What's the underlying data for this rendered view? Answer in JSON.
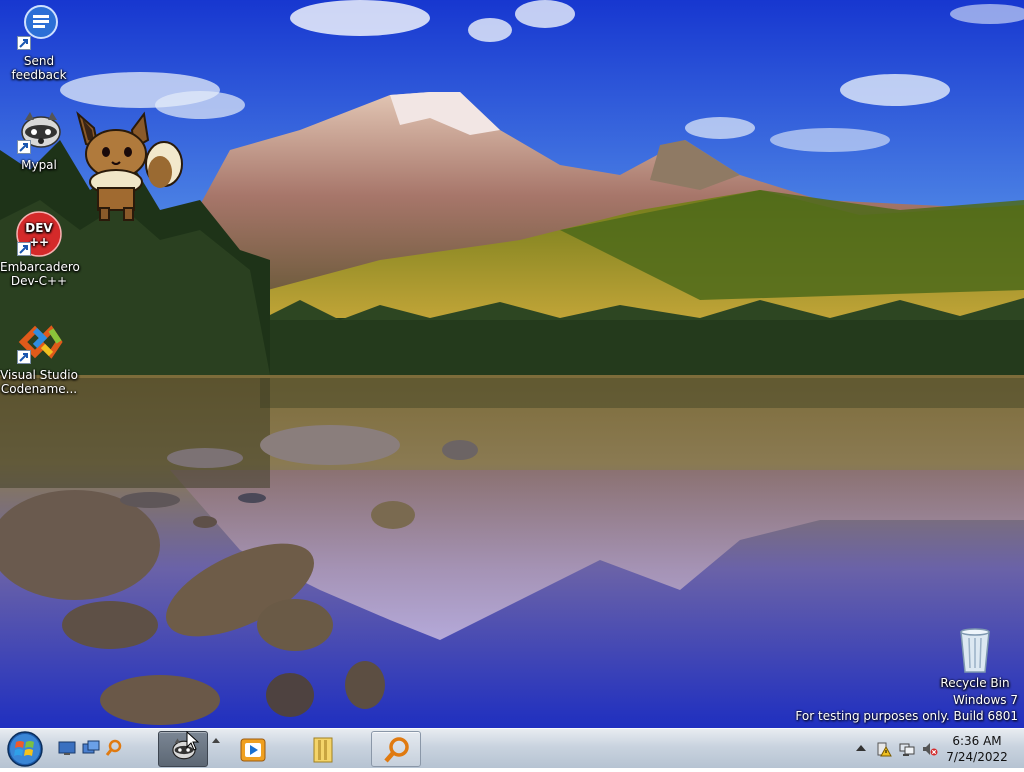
{
  "desktop": {
    "icons": [
      {
        "label": "Send feedback",
        "icon": "feedback-icon"
      },
      {
        "label": "Mypal",
        "icon": "mypal-icon"
      },
      {
        "label": "Embarcadero Dev-C++",
        "icon": "dev-cpp-icon"
      },
      {
        "label": "Visual Studio Codename...",
        "icon": "vscode-icon"
      },
      {
        "label": "Recycle Bin",
        "icon": "recycle-bin-icon"
      }
    ],
    "overlay_sprite": "eevee-sprite",
    "devcpp_badge_text": "DEV\n++"
  },
  "watermark": {
    "line1": "Windows 7",
    "line2": "For testing purposes only. Build 6801"
  },
  "taskbar": {
    "start_icon": "windows-orb-icon",
    "quick_launch": [
      "show-desktop-icon",
      "switch-windows-icon",
      "search-icon"
    ],
    "buttons": [
      {
        "name": "mypal",
        "icon": "mypal-icon",
        "active": true
      },
      {
        "name": "media-player",
        "icon": "media-player-icon",
        "active": false
      },
      {
        "name": "explorer",
        "icon": "folder-icon",
        "active": false
      },
      {
        "name": "search",
        "icon": "magnifier-icon",
        "active": false
      }
    ],
    "tray": {
      "icons": [
        "show-hidden-icons",
        "action-center-icon",
        "network-icon",
        "volume-muted-icon"
      ],
      "time": "6:36 AM",
      "date": "7/24/2022"
    }
  },
  "colors": {
    "sky_top": "#1f3fd0",
    "lake": "#2233c6",
    "taskbar": "#c9d3df",
    "accent_orange": "#f0a020"
  }
}
